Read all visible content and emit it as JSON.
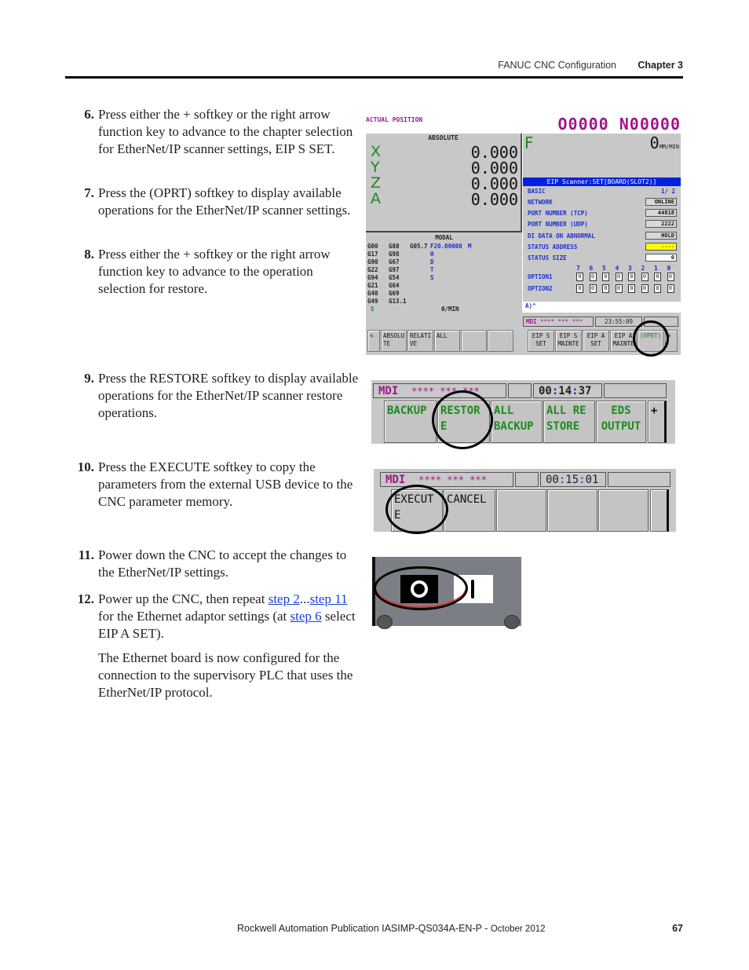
{
  "header": {
    "section": "FANUC CNC Configuration",
    "chapter": "Chapter 3"
  },
  "steps": [
    {
      "num": "6.",
      "text": "Press either the + softkey or the right arrow function key to advance to the chapter selection for EtherNet/IP scanner settings, EIP S SET."
    },
    {
      "num": "7.",
      "text": "Press the (OPRT) softkey to display available operations for the EtherNet/IP scanner settings."
    },
    {
      "num": "8.",
      "text": "Press either the + softkey or the right arrow function key to advance to the operation selection for restore."
    },
    {
      "num": "9.",
      "text": "Press the RESTORE softkey to display available operations for the EtherNet/IP scanner restore operations."
    },
    {
      "num": "10.",
      "text": "Press the EXECUTE softkey to copy the parameters from the external USB device to the CNC parameter memory."
    },
    {
      "num": "11.",
      "text": "Power down the CNC to accept the changes to the EtherNet/IP settings."
    },
    {
      "num": "12.",
      "pre": "Power up the CNC, then repeat ",
      "link1": "step 2",
      "mid1": "...",
      "link2": "step 11",
      "mid2": " for the Ethernet adaptor settings (at ",
      "link3": "step 6",
      "post": " select EIP A SET)."
    }
  ],
  "closing_paragraph": "The Ethernet board is now configured for the connection to the supervisory PLC that uses the EtherNet/IP protocol.",
  "cnc_screen": {
    "actual_position": "ACTUAL POSITION",
    "program_number": "O0000 N00000",
    "absolute_label": "ABSOLUTE",
    "axes": [
      {
        "name": "X",
        "value": "0.000"
      },
      {
        "name": "Y",
        "value": "0.000"
      },
      {
        "name": "Z",
        "value": "0.000"
      },
      {
        "name": "A",
        "value": "0.000"
      }
    ],
    "feed_label": "F",
    "feed_value": "0",
    "feed_unit": "MM/MIN",
    "eip_title": "EIP Scanner:SET[BOARD(SLOT2)]",
    "basic_label": "BASIC",
    "page": "1/ 2",
    "settings": [
      {
        "label": "NETWORK",
        "value": "ONLINE",
        "style": ""
      },
      {
        "label": "PORT NUMBER (TCP)",
        "value": "44818",
        "style": ""
      },
      {
        "label": "PORT NUMBER (UDP)",
        "value": "2222",
        "style": ""
      },
      {
        "label": "DI DATA ON ABNORMAL",
        "value": "HOLD",
        "style": ""
      },
      {
        "label": "STATUS ADDRESS",
        "value": "----",
        "style": "yellow"
      },
      {
        "label": "STATUS SIZE",
        "value": "0",
        "style": "white"
      }
    ],
    "bit_numbers": [
      "7",
      "6",
      "5",
      "4",
      "3",
      "2",
      "1",
      "0"
    ],
    "option1_label": "OPTION1",
    "option1_bits": [
      "0",
      "0",
      "0",
      "0",
      "0",
      "0",
      "0",
      "0"
    ],
    "option2_label": "OPTION2",
    "option2_bits": [
      "0",
      "0",
      "0",
      "0",
      "0",
      "0",
      "0",
      "0"
    ],
    "prompt": "A)^",
    "modal_label": "MODAL",
    "modal_rows": [
      [
        "G00",
        "G80",
        "G05.7",
        "F20.00000",
        "M"
      ],
      [
        "G17",
        "G98",
        "",
        "",
        "H"
      ],
      [
        "G90",
        "G67",
        "",
        "",
        "D"
      ],
      [
        "G22",
        "G97",
        "",
        "",
        "T"
      ],
      [
        "G94",
        "G54",
        "",
        "",
        "S"
      ],
      [
        "G21",
        "G64",
        "",
        "",
        ""
      ],
      [
        "G40",
        "G69",
        "",
        "",
        ""
      ],
      [
        "G49",
        "G13.1",
        "",
        "",
        ""
      ]
    ],
    "spindle_label": "S",
    "spindle_unit": "0/MIN",
    "status_mode": "MDI",
    "status_stars": "**** *** ***",
    "status_time": "23:55:09",
    "left_softkeys": [
      "<",
      "ABSOLU TE",
      "RELATI VE",
      "ALL",
      "",
      ""
    ],
    "right_softkeys": [
      "EIP S SET",
      "EIP S MAINTE",
      "EIP A SET",
      "EIP A MAINTE",
      "(OPRT)",
      "+"
    ]
  },
  "restore_panel": {
    "mode": "MDI",
    "stars": "**** *** ***",
    "time_h": "00",
    "time_m": "14",
    "time_s": "37",
    "buttons": [
      "BACKUP",
      "RESTOR E",
      "ALL BACKUP",
      "ALL RE STORE",
      "EDS OUTPUT",
      "+"
    ]
  },
  "execute_panel": {
    "mode": "MDI",
    "stars": "**** *** ***",
    "time_h": "00",
    "time_m": "15",
    "time_s": "01",
    "buttons": [
      "EXECUT E",
      "CANCEL",
      "",
      "",
      "",
      ""
    ]
  },
  "power_switch": {
    "off_symbol": "O",
    "on_symbol": "I"
  },
  "footer": {
    "publication": "Rockwell Automation Publication IASIMP-QS034A-EN-P - ",
    "date": "October 2012",
    "page": "67"
  }
}
